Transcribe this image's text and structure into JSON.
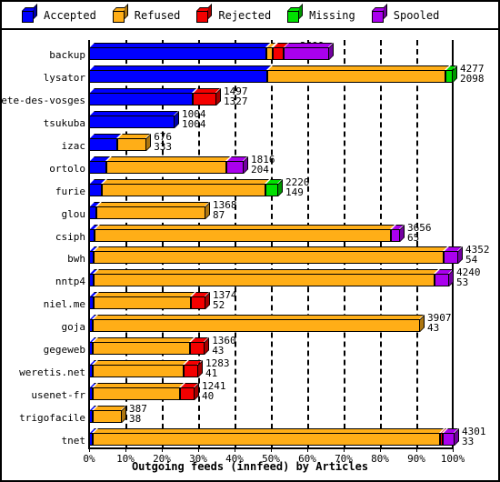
{
  "legend": {
    "items": [
      {
        "label": "Accepted",
        "color": "#0000ff",
        "icon": "cube-icon"
      },
      {
        "label": "Refused",
        "color": "#ffae17",
        "icon": "cube-icon"
      },
      {
        "label": "Rejected",
        "color": "#f40000",
        "icon": "cube-icon"
      },
      {
        "label": "Missing",
        "color": "#00e000",
        "icon": "cube-icon"
      },
      {
        "label": "Spooled",
        "color": "#aa00ee",
        "icon": "cube-icon"
      }
    ]
  },
  "chart_data": {
    "type": "bar",
    "orientation": "horizontal",
    "stacked": true,
    "normalized": true,
    "title": "Outgoing feeds (innfeed) by Articles",
    "xlabel": "Outgoing feeds (innfeed) by Articles",
    "ylabel": "",
    "xlim": [
      0,
      100
    ],
    "xticks": [
      "0%",
      "10%",
      "20%",
      "30%",
      "40%",
      "50%",
      "60%",
      "70%",
      "80%",
      "90%",
      "100%"
    ],
    "grid": true,
    "legend_position": "top",
    "series_names": [
      "Accepted",
      "Refused",
      "Rejected",
      "Missing",
      "Spooled"
    ],
    "series_colors": [
      "#0000ff",
      "#ffae17",
      "#f40000",
      "#00e000",
      "#aa00ee"
    ],
    "categories": [
      "backup",
      "lysator",
      "bete-des-vosges",
      "tsukuba",
      "izac",
      "ortolo",
      "furie",
      "glou",
      "csiph",
      "bwh",
      "nntp4",
      "niel.me",
      "goja",
      "gegeweb",
      "weretis.net",
      "usenet-fr",
      "trigofacile",
      "tnet"
    ],
    "rows": [
      {
        "name": "backup",
        "total": 2699,
        "value2": 2296,
        "bar_end_pct": 56.0,
        "segments": [
          {
            "series": "Accepted",
            "pct": 48.8
          },
          {
            "series": "Refused",
            "pct": 1.6
          },
          {
            "series": "Rejected",
            "pct": 3.2
          },
          {
            "series": "Spooled",
            "pct": 12.4
          }
        ]
      },
      {
        "name": "lysator",
        "total": 4277,
        "value2": 2098,
        "bar_end_pct": 100.0,
        "segments": [
          {
            "series": "Accepted",
            "pct": 49.0
          },
          {
            "series": "Refused",
            "pct": 49.0
          },
          {
            "series": "Missing",
            "pct": 2.0
          }
        ]
      },
      {
        "name": "bete-des-vosges",
        "total": 1497,
        "value2": 1327,
        "bar_end_pct": 35.0,
        "segments": [
          {
            "series": "Accepted",
            "pct": 28.6
          },
          {
            "series": "Rejected",
            "pct": 6.4
          }
        ]
      },
      {
        "name": "tsukuba",
        "total": 1004,
        "value2": 1004,
        "bar_end_pct": 23.5,
        "segments": [
          {
            "series": "Accepted",
            "pct": 23.5
          }
        ]
      },
      {
        "name": "izac",
        "total": 676,
        "value2": 333,
        "bar_end_pct": 15.8,
        "segments": [
          {
            "series": "Accepted",
            "pct": 7.8
          },
          {
            "series": "Refused",
            "pct": 8.0
          }
        ]
      },
      {
        "name": "ortolo",
        "total": 1816,
        "value2": 204,
        "bar_end_pct": 42.5,
        "segments": [
          {
            "series": "Accepted",
            "pct": 4.8
          },
          {
            "series": "Refused",
            "pct": 32.9
          },
          {
            "series": "Spooled",
            "pct": 4.8
          }
        ]
      },
      {
        "name": "furie",
        "total": 2220,
        "value2": 149,
        "bar_end_pct": 52.0,
        "segments": [
          {
            "series": "Accepted",
            "pct": 3.5
          },
          {
            "series": "Refused",
            "pct": 45.0
          },
          {
            "series": "Missing",
            "pct": 3.5
          }
        ]
      },
      {
        "name": "glou",
        "total": 1368,
        "value2": 87,
        "bar_end_pct": 32.0,
        "segments": [
          {
            "series": "Accepted",
            "pct": 2.0
          },
          {
            "series": "Refused",
            "pct": 30.0
          }
        ]
      },
      {
        "name": "csiph",
        "total": 3656,
        "value2": 65,
        "bar_end_pct": 85.5,
        "segments": [
          {
            "series": "Accepted",
            "pct": 1.5
          },
          {
            "series": "Refused",
            "pct": 81.5
          },
          {
            "series": "Spooled",
            "pct": 2.5
          }
        ]
      },
      {
        "name": "bwh",
        "total": 4352,
        "value2": 54,
        "bar_end_pct": 101.5,
        "segments": [
          {
            "series": "Accepted",
            "pct": 1.2
          },
          {
            "series": "Refused",
            "pct": 96.3
          },
          {
            "series": "Spooled",
            "pct": 4.0
          }
        ]
      },
      {
        "name": "nntp4",
        "total": 4240,
        "value2": 53,
        "bar_end_pct": 99.0,
        "segments": [
          {
            "series": "Accepted",
            "pct": 1.2
          },
          {
            "series": "Refused",
            "pct": 93.8
          },
          {
            "series": "Spooled",
            "pct": 4.0
          }
        ]
      },
      {
        "name": "niel.me",
        "total": 1374,
        "value2": 52,
        "bar_end_pct": 32.0,
        "segments": [
          {
            "series": "Accepted",
            "pct": 1.2
          },
          {
            "series": "Refused",
            "pct": 26.8
          },
          {
            "series": "Rejected",
            "pct": 4.0
          }
        ]
      },
      {
        "name": "goja",
        "total": 3907,
        "value2": 43,
        "bar_end_pct": 91.0,
        "segments": [
          {
            "series": "Accepted",
            "pct": 1.0
          },
          {
            "series": "Refused",
            "pct": 90.0
          }
        ]
      },
      {
        "name": "gegeweb",
        "total": 1360,
        "value2": 43,
        "bar_end_pct": 31.8,
        "segments": [
          {
            "series": "Accepted",
            "pct": 1.0
          },
          {
            "series": "Refused",
            "pct": 26.8
          },
          {
            "series": "Rejected",
            "pct": 4.0
          }
        ]
      },
      {
        "name": "weretis.net",
        "total": 1283,
        "value2": 41,
        "bar_end_pct": 30.0,
        "segments": [
          {
            "series": "Accepted",
            "pct": 1.0
          },
          {
            "series": "Refused",
            "pct": 25.0
          },
          {
            "series": "Rejected",
            "pct": 4.0
          }
        ]
      },
      {
        "name": "usenet-fr",
        "total": 1241,
        "value2": 40,
        "bar_end_pct": 29.0,
        "segments": [
          {
            "series": "Accepted",
            "pct": 1.0
          },
          {
            "series": "Refused",
            "pct": 24.0
          },
          {
            "series": "Rejected",
            "pct": 4.0
          }
        ]
      },
      {
        "name": "trigofacile",
        "total": 387,
        "value2": 38,
        "bar_end_pct": 9.0,
        "segments": [
          {
            "series": "Accepted",
            "pct": 1.0
          },
          {
            "series": "Refused",
            "pct": 8.0
          }
        ]
      },
      {
        "name": "tnet",
        "total": 4301,
        "value2": 33,
        "bar_end_pct": 100.5,
        "segments": [
          {
            "series": "Accepted",
            "pct": 1.0
          },
          {
            "series": "Refused",
            "pct": 95.5
          },
          {
            "series": "Rejected",
            "pct": 0.8
          },
          {
            "series": "Spooled",
            "pct": 3.2
          }
        ]
      }
    ]
  }
}
